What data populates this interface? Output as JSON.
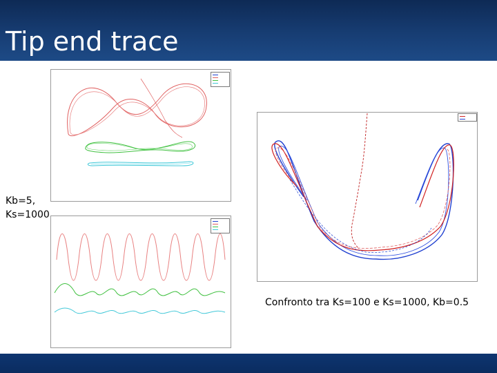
{
  "slide": {
    "title": "Tip end trace",
    "left_label_line1": "Kb=5,",
    "left_label_line2": "Ks=1000",
    "right_caption": "Confronto tra Ks=100 e Ks=1000, Kb=0.5"
  },
  "colors": {
    "title_bar": "#173d73",
    "footer_bar": "#0a2c60",
    "trace_red": "#e06060",
    "trace_green": "#40c040",
    "trace_cyan": "#40c8d8",
    "trace_blue": "#2040d0",
    "trace_red_dark": "#d02020"
  },
  "figures": {
    "top_left": {
      "legend": [
        "",
        "",
        "",
        ""
      ]
    },
    "bottom_left": {
      "legend": [
        "",
        "",
        "",
        ""
      ]
    },
    "right": {
      "legend": [
        "",
        ""
      ]
    }
  }
}
